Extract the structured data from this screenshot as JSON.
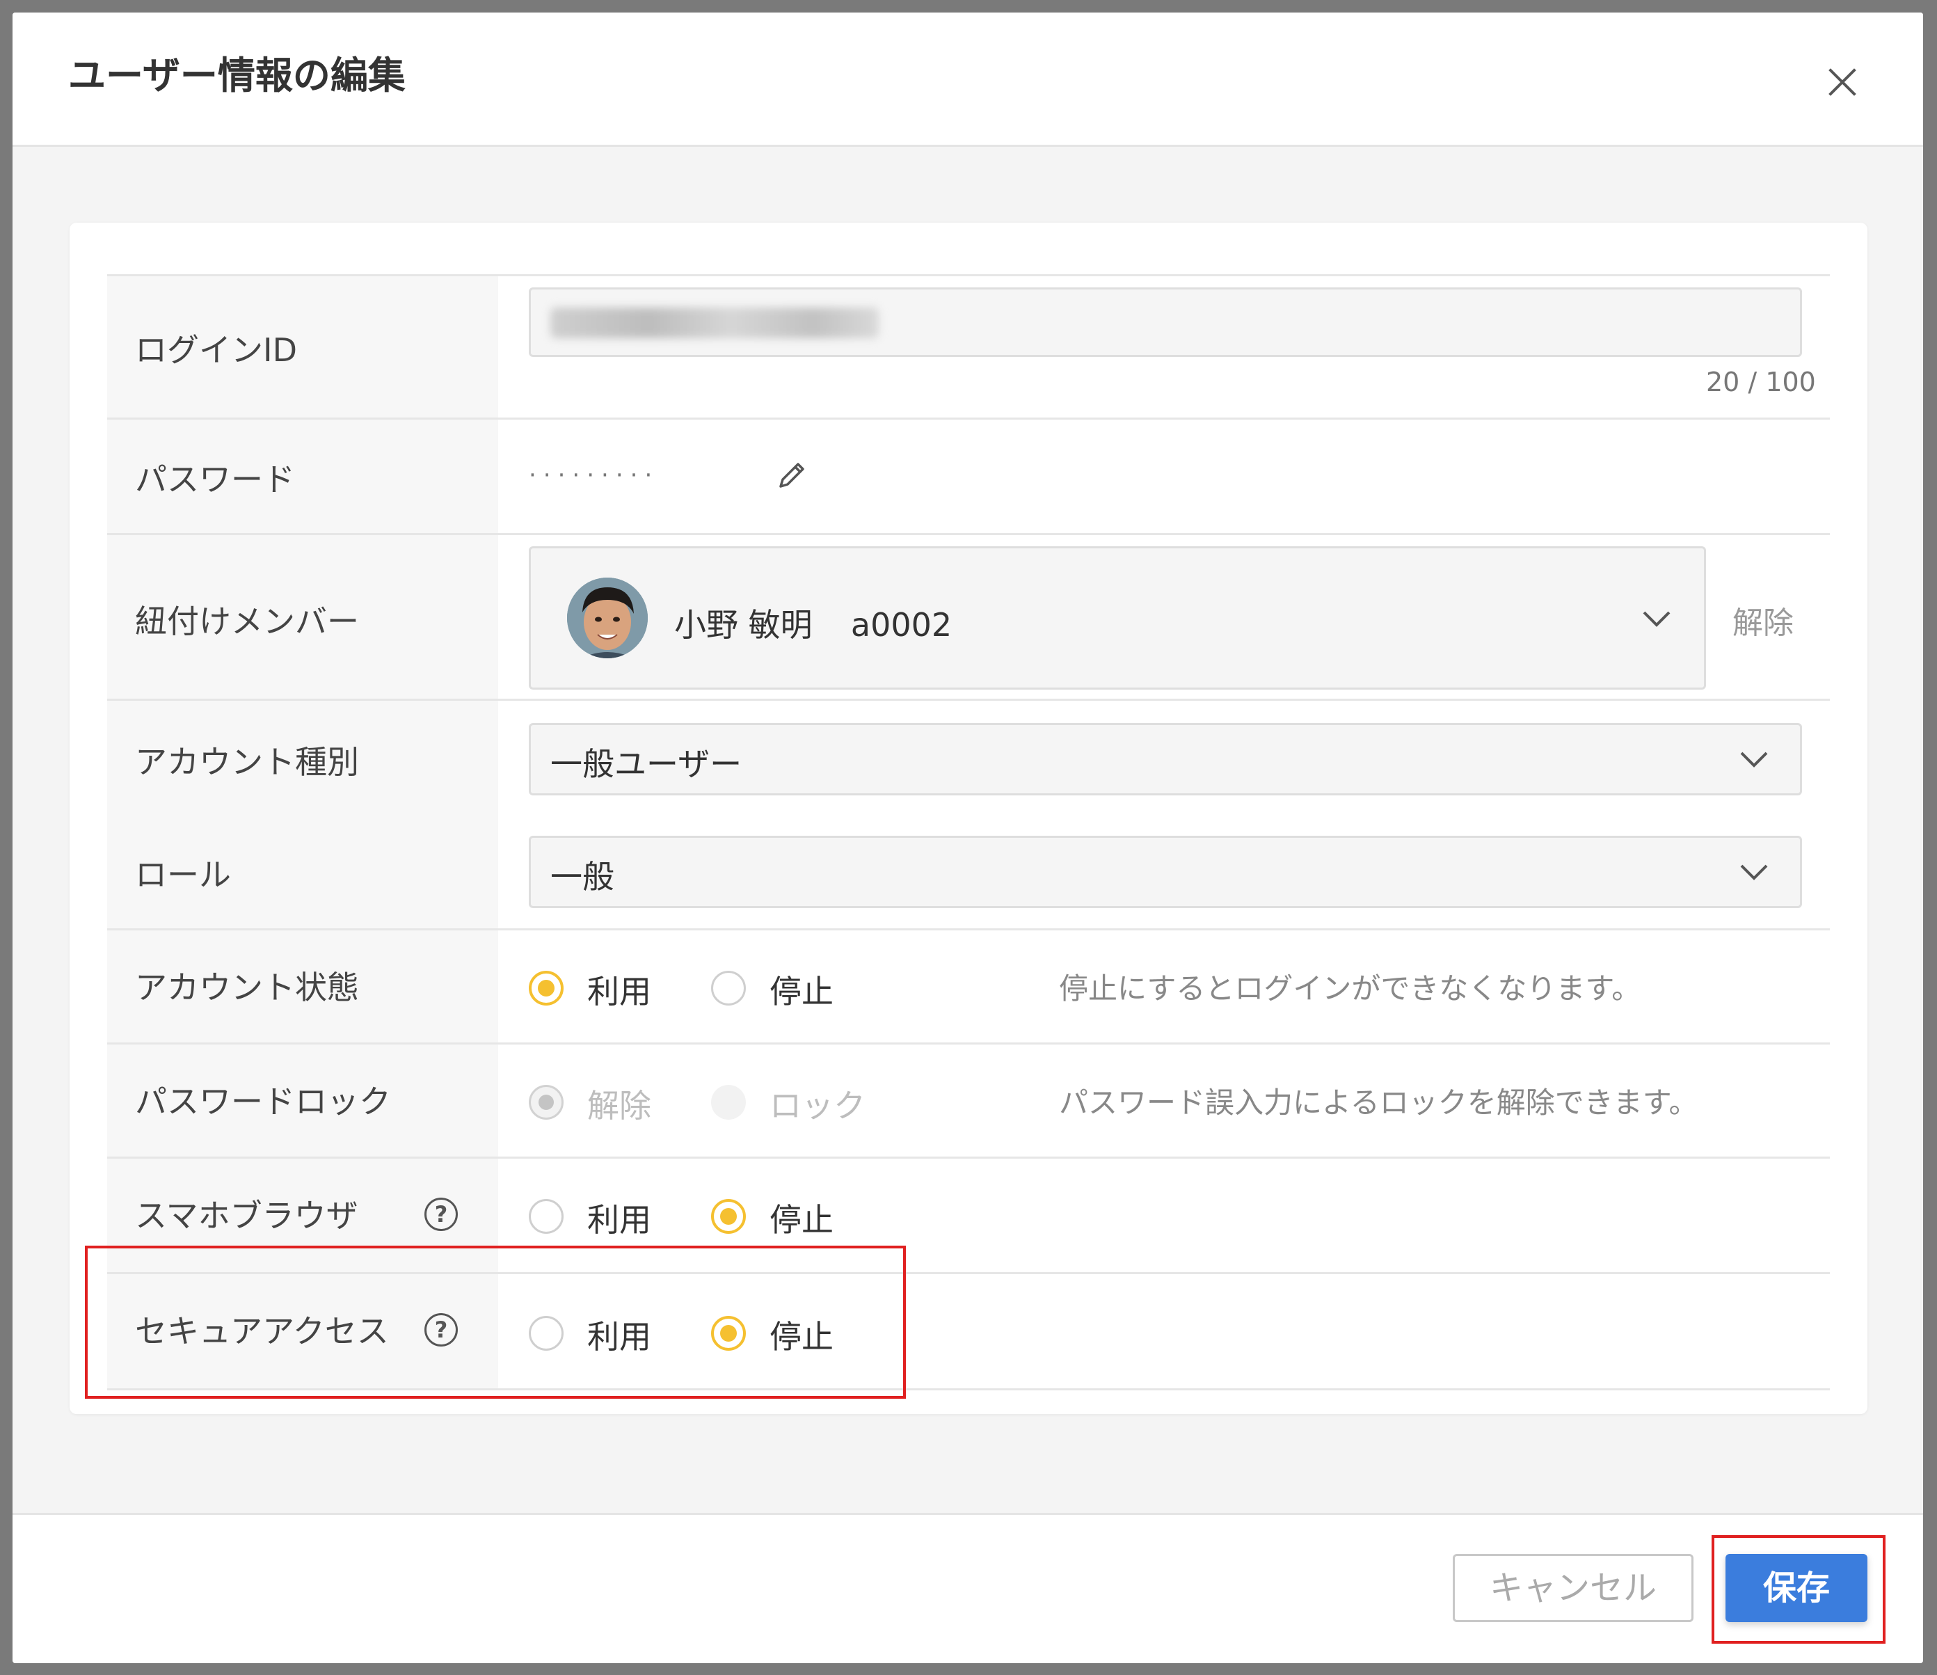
{
  "dialog": {
    "title": "ユーザー情報の編集"
  },
  "form": {
    "login_id": {
      "label": "ログインID",
      "counter": "20 / 100"
    },
    "password": {
      "label": "パスワード",
      "mask": "·········"
    },
    "linked_member": {
      "label": "紐付けメンバー",
      "name": "小野 敏明",
      "code": "a0002",
      "unlink_label": "解除"
    },
    "account_type": {
      "label": "アカウント種別",
      "value": "一般ユーザー"
    },
    "role": {
      "label": "ロール",
      "value": "一般"
    },
    "account_status": {
      "label": "アカウント状態",
      "options": [
        "利用",
        "停止"
      ],
      "selected": "利用",
      "hint": "停止にするとログインができなくなります。"
    },
    "password_lock": {
      "label": "パスワードロック",
      "options": [
        "解除",
        "ロック"
      ],
      "selected": "解除",
      "disabled": true,
      "hint": "パスワード誤入力によるロックを解除できます。"
    },
    "smartphone_browser": {
      "label": "スマホブラウザ",
      "help_symbol": "?",
      "options": [
        "利用",
        "停止"
      ],
      "selected": "停止"
    },
    "secure_access": {
      "label": "セキュアアクセス",
      "help_symbol": "?",
      "options": [
        "利用",
        "停止"
      ],
      "selected": "停止"
    }
  },
  "footer": {
    "cancel_label": "キャンセル",
    "save_label": "保存"
  },
  "colors": {
    "accent_radio": "#f5c030",
    "primary_button": "#3b7ddd",
    "highlight": "#e02020"
  }
}
